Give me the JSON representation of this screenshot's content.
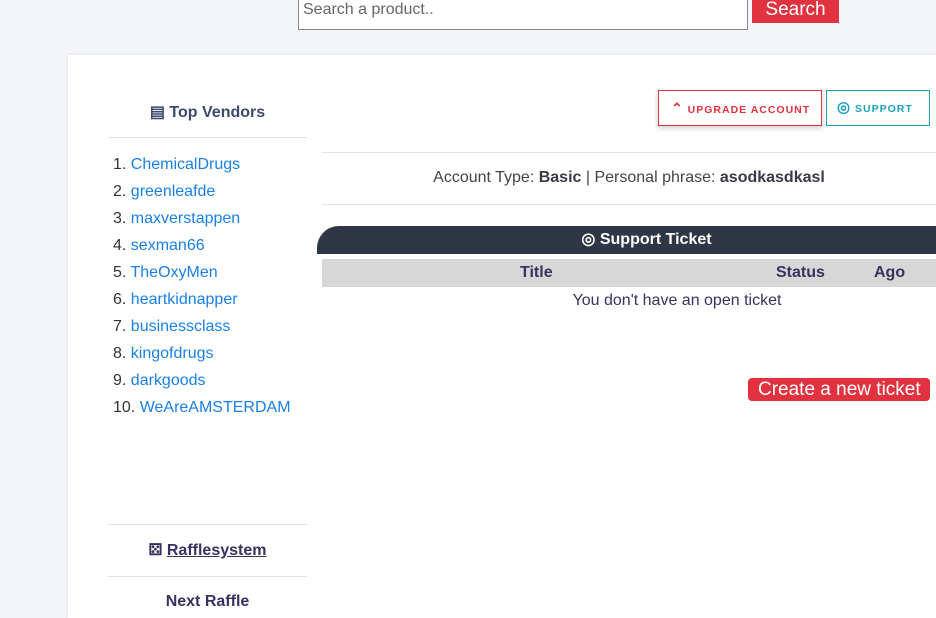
{
  "search": {
    "placeholder": "Search a product..",
    "button": "Search"
  },
  "sidebar": {
    "title": "Top Vendors",
    "vendors": [
      "ChemicalDrugs",
      "greenleafde",
      "maxverstappen",
      "sexman66",
      "TheOxyMen",
      "heartkidnapper",
      "businessclass",
      "kingofdrugs",
      "darkgoods",
      "WeAreAMSTERDAM"
    ],
    "raffle_link": "Rafflesystem",
    "next_raffle": "Next Raffle"
  },
  "header": {
    "upgrade": "UPGRADE ACCOUNT",
    "support": "SUPPORT"
  },
  "account": {
    "type_label": "Account Type:",
    "type": "Basic",
    "phrase_label": "| Personal phrase:",
    "phrase": "asodkasdkasl"
  },
  "tickets": {
    "title": "Support Ticket",
    "columns": [
      "Title",
      "Status",
      "Ago"
    ],
    "empty": "You don't have an open ticket",
    "create": "Create a new ticket"
  },
  "colors": {
    "accent": "#e0323f",
    "support": "#1aa3b8",
    "header_bg": "#2f3747",
    "link": "#1a80e8"
  }
}
